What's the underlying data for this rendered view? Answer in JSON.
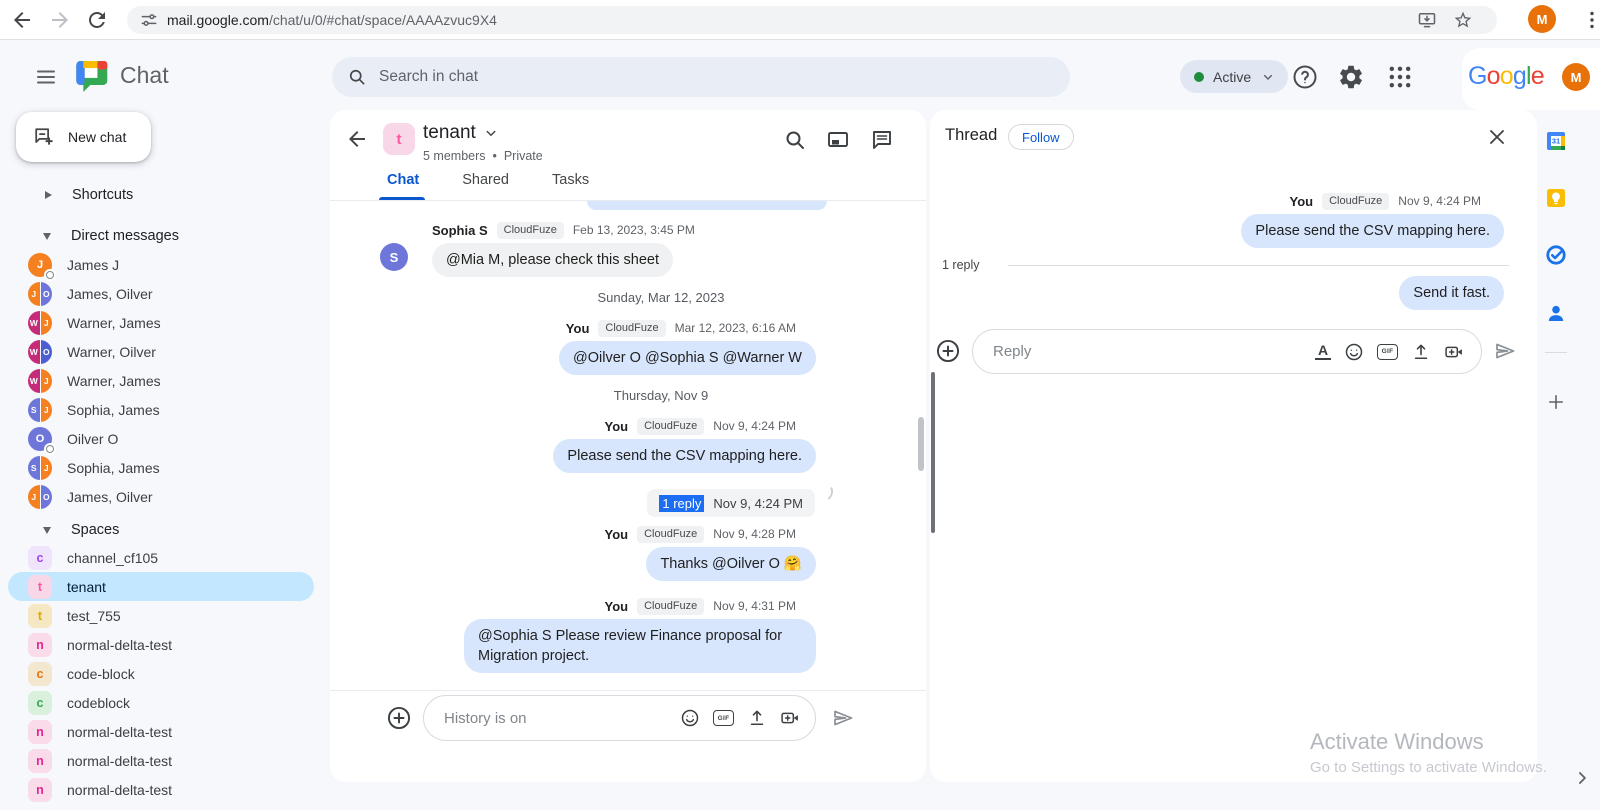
{
  "browser": {
    "url_domain": "mail.google.com",
    "url_path": "/chat/u/0/#chat/space/AAAAzvuc9X4",
    "avatar_initial": "M",
    "icons": [
      "back-arrow",
      "forward-arrow",
      "reload",
      "site-settings-tune",
      "install-monitor-download",
      "bookmark-star",
      "kebab-menu"
    ]
  },
  "header": {
    "app_name": "Chat",
    "search_placeholder": "Search in chat",
    "status": {
      "label": "Active",
      "dot_color": "#1e8e3e"
    },
    "icons": [
      "menu",
      "help",
      "settings-gear",
      "apps-grid"
    ],
    "google_letters": [
      {
        "ch": "G",
        "color": "#4285F4"
      },
      {
        "ch": "o",
        "color": "#EA4335"
      },
      {
        "ch": "o",
        "color": "#FBBC05"
      },
      {
        "ch": "g",
        "color": "#4285F4"
      },
      {
        "ch": "l",
        "color": "#34A853"
      },
      {
        "ch": "e",
        "color": "#EA4335"
      }
    ],
    "avatar_initial": "M"
  },
  "sidebar": {
    "new_chat_label": "New chat",
    "sections": {
      "shortcuts": {
        "label": "Shortcuts",
        "collapsed": true
      },
      "direct_messages": {
        "label": "Direct messages",
        "collapsed": false
      },
      "spaces": {
        "label": "Spaces",
        "collapsed": false
      }
    },
    "direct_messages": [
      {
        "name": "James J",
        "avatar": {
          "kind": "single",
          "letter": "J",
          "color": "#f4801f"
        },
        "presence": true
      },
      {
        "name": "James, Oilver",
        "avatar": {
          "kind": "split",
          "left": {
            "letter": "J",
            "color": "#f4801f"
          },
          "right": {
            "letter": "O",
            "color": "#6e76d9"
          }
        }
      },
      {
        "name": "Warner, James",
        "avatar": {
          "kind": "split",
          "left": {
            "letter": "W",
            "color": "#c62b7a"
          },
          "right": {
            "letter": "J",
            "color": "#f4801f"
          }
        }
      },
      {
        "name": "Warner, Oilver",
        "avatar": {
          "kind": "split",
          "left": {
            "letter": "W",
            "color": "#c62b7a"
          },
          "right": {
            "letter": "O",
            "color": "#4d5ed2"
          }
        }
      },
      {
        "name": "Warner, James",
        "avatar": {
          "kind": "split",
          "left": {
            "letter": "W",
            "color": "#c62b7a"
          },
          "right": {
            "letter": "J",
            "color": "#f4801f"
          }
        }
      },
      {
        "name": "Sophia, James",
        "avatar": {
          "kind": "split",
          "left": {
            "letter": "S",
            "color": "#6e76d9"
          },
          "right": {
            "letter": "J",
            "color": "#f4801f"
          }
        }
      },
      {
        "name": "Oilver O",
        "avatar": {
          "kind": "single",
          "letter": "O",
          "color": "#6e76d9"
        },
        "presence": true
      },
      {
        "name": "Sophia, James",
        "avatar": {
          "kind": "split",
          "left": {
            "letter": "S",
            "color": "#6e76d9"
          },
          "right": {
            "letter": "J",
            "color": "#f4801f"
          }
        }
      },
      {
        "name": "James, Oilver",
        "avatar": {
          "kind": "split",
          "left": {
            "letter": "J",
            "color": "#f4801f"
          },
          "right": {
            "letter": "O",
            "color": "#6e76d9"
          }
        }
      }
    ],
    "spaces": [
      {
        "name": "channel_cf105",
        "letter": "c",
        "bg": "#f0e3fc",
        "color": "#a142f4",
        "selected": false
      },
      {
        "name": "tenant",
        "letter": "t",
        "bg": "#f8d7e8",
        "color": "#ff56a4",
        "selected": true
      },
      {
        "name": "test_755",
        "letter": "t",
        "bg": "#f6e7c3",
        "color": "#e0a800",
        "selected": false
      },
      {
        "name": "normal-delta-test",
        "letter": "n",
        "bg": "#fadbe9",
        "color": "#e52592",
        "selected": false
      },
      {
        "name": "code-block",
        "letter": "c",
        "bg": "#f3e8cf",
        "color": "#e8710a",
        "selected": false
      },
      {
        "name": "codeblock",
        "letter": "c",
        "bg": "#d9f0dd",
        "color": "#34a853",
        "selected": false
      },
      {
        "name": "normal-delta-test",
        "letter": "n",
        "bg": "#fadbe9",
        "color": "#e52592",
        "selected": false
      },
      {
        "name": "normal-delta-test",
        "letter": "n",
        "bg": "#fadbe9",
        "color": "#e52592",
        "selected": false
      },
      {
        "name": "normal-delta-test",
        "letter": "n",
        "bg": "#fadbe9",
        "color": "#e52592",
        "selected": false
      }
    ]
  },
  "chat": {
    "title": "tenant",
    "avatar": {
      "letter": "t",
      "bg": "#f8d7e8",
      "color": "#ff56a4"
    },
    "members": "5 members",
    "separator": "•",
    "privacy": "Private",
    "header_icons": [
      "search",
      "picture-in-picture",
      "open-chat-window"
    ],
    "tabs": [
      {
        "label": "Chat",
        "active": true
      },
      {
        "label": "Shared",
        "active": false
      },
      {
        "label": "Tasks",
        "active": false
      }
    ],
    "messages": [
      {
        "type": "truncated-bubble"
      },
      {
        "type": "message",
        "side": "left",
        "sender": "Sophia S",
        "badge": "CloudFuze",
        "time": "Feb 13, 2023, 3:45 PM",
        "text": "@Mia M, please check this sheet",
        "avatar": {
          "letter": "S",
          "color": "#6e76d9"
        }
      },
      {
        "type": "date",
        "label": "Sunday, Mar 12, 2023"
      },
      {
        "type": "message",
        "side": "right",
        "sender": "You",
        "badge": "CloudFuze",
        "time": "Mar 12, 2023, 6:16 AM",
        "text": "@Oilver O @Sophia S @Warner W"
      },
      {
        "type": "date",
        "label": "Thursday, Nov 9"
      },
      {
        "type": "message",
        "side": "right",
        "sender": "You",
        "badge": "CloudFuze",
        "time": "Nov 9, 4:24 PM",
        "text": "Please send the CSV mapping here."
      },
      {
        "type": "thread-chip",
        "reply_label": "1 reply",
        "time": "Nov 9, 4:24 PM"
      },
      {
        "type": "message",
        "side": "right",
        "sender": "You",
        "badge": "CloudFuze",
        "time": "Nov 9, 4:28 PM",
        "text": "Thanks @Oilver O 🤗"
      },
      {
        "type": "message",
        "side": "right",
        "sender": "You",
        "badge": "CloudFuze",
        "time": "Nov 9, 4:31 PM",
        "text": "@Sophia S Please review Finance proposal for Migration project.",
        "wide": true
      }
    ],
    "compose": {
      "placeholder": "History is on",
      "icons": [
        "add-plus",
        "emoji",
        "gif",
        "upload",
        "video-meet",
        "send"
      ]
    }
  },
  "thread": {
    "title": "Thread",
    "follow_label": "Follow",
    "messages": [
      {
        "sender": "You",
        "badge": "CloudFuze",
        "time": "Nov 9, 4:24 PM",
        "text": "Please send the CSV mapping here."
      },
      {
        "type": "reply-divider",
        "label": "1 reply"
      },
      {
        "text": "Send it fast."
      }
    ],
    "compose": {
      "placeholder": "Reply",
      "icons": [
        "add-plus",
        "format-text",
        "emoji",
        "gif",
        "upload",
        "video-meet",
        "send"
      ]
    }
  },
  "right_rail": {
    "items": [
      "google-calendar",
      "google-keep",
      "google-tasks",
      "google-contacts",
      "get-add-ons",
      "expand-panel"
    ]
  },
  "watermark": {
    "line1": "Activate Windows",
    "line2": "Go to Settings to activate Windows."
  },
  "colors": {
    "accent_blue": "#0b57d0",
    "bubble_outgoing": "#d7e5fd",
    "bubble_incoming": "#f0f1f2",
    "selected_space": "#c2e7ff",
    "presence_active": "#1e8e3e",
    "reply_selection": "#1b6ef3",
    "app_background": "#f6f8fc"
  }
}
